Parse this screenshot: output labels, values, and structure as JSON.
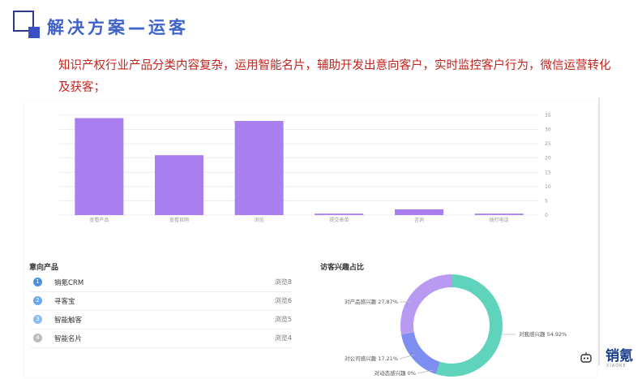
{
  "title": "解决方案—运客",
  "description": "知识产权行业产品分类内容复杂，运用智能名片，辅助开发出意向客户，实时监控客户行为，微信运营转化及获客；",
  "chart_data": [
    {
      "type": "bar",
      "categories": [
        "查看产品",
        "查看官网",
        "浏览",
        "提交表单",
        "咨询",
        "拨打电话"
      ],
      "values": [
        34,
        21,
        33,
        0.5,
        2,
        0.5
      ],
      "ylim": [
        0,
        35
      ],
      "yticks": [
        0,
        5,
        10,
        15,
        20,
        25,
        30,
        35
      ],
      "bar_color": "#a97ff0",
      "grid": true
    },
    {
      "type": "pie",
      "title": "访客兴趣占比",
      "slices": [
        {
          "label": "对我感兴趣 54.92%",
          "value": 54.92,
          "color": "#5fd3bb"
        },
        {
          "label": "对公司感兴趣 17.21%",
          "value": 17.21,
          "color": "#7e8ef0"
        },
        {
          "label": "对产品感兴趣 27.87%",
          "value": 27.87,
          "color": "#b89af2"
        },
        {
          "label": "对动态感兴趣 0%",
          "value": 0,
          "color": "#cccccc"
        }
      ]
    }
  ],
  "products": {
    "title": "意向产品",
    "items": [
      {
        "rank": "1",
        "name": "销氪CRM",
        "count": "浏览8",
        "color": "#4a90e2"
      },
      {
        "rank": "2",
        "name": "寻客宝",
        "count": "浏览6",
        "color": "#6aa8f0"
      },
      {
        "rank": "3",
        "name": "智能触客",
        "count": "浏览5",
        "color": "#8bbcf3"
      },
      {
        "rank": "4",
        "name": "智能名片",
        "count": "浏览4",
        "color": "#bbbbbb"
      }
    ]
  },
  "brand": {
    "name": "销氪",
    "sub": "XIAOKE"
  }
}
